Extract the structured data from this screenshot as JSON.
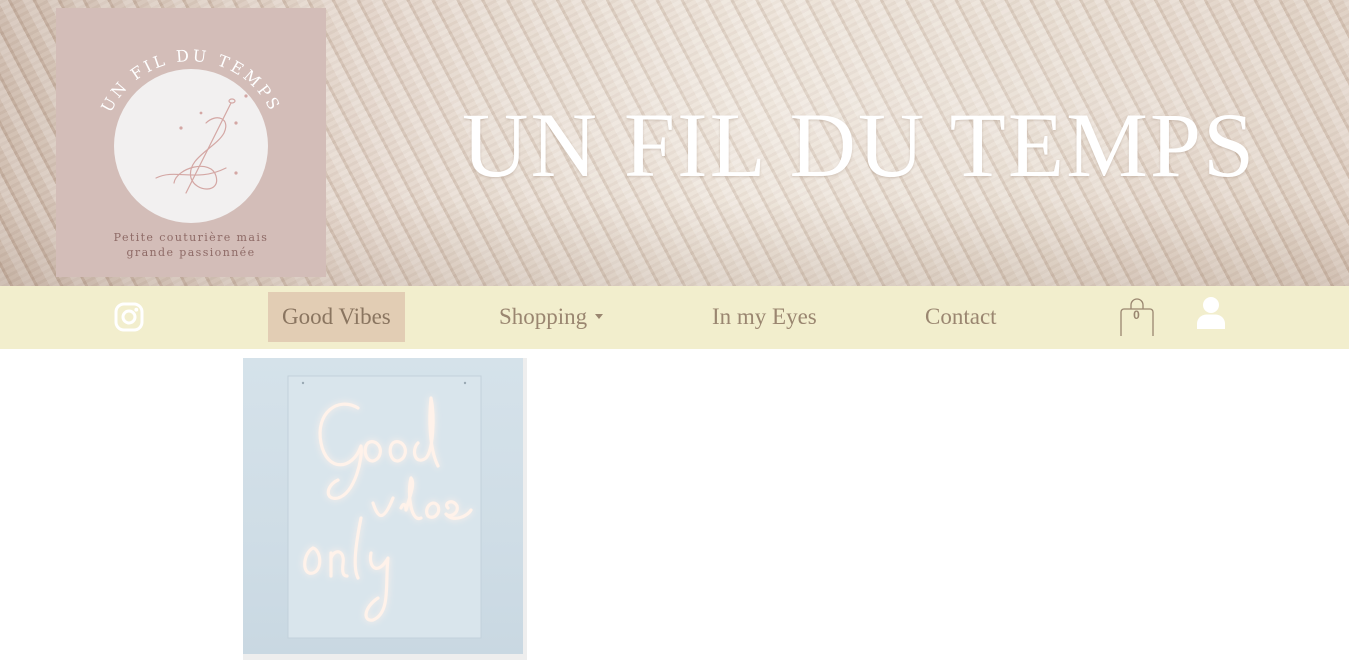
{
  "header": {
    "site_title": "UN FIL DU TEMPS",
    "logo": {
      "arc_text": "UN FIL DU TEMPS",
      "tagline_line1": "Petite couturière mais",
      "tagline_line2": "grande passionnée"
    }
  },
  "nav": {
    "items": [
      {
        "label": "Good Vibes",
        "active": true
      },
      {
        "label": "Shopping",
        "has_dropdown": true
      },
      {
        "label": "In my Eyes"
      },
      {
        "label": "Contact"
      }
    ],
    "cart_count": "0",
    "icons": [
      "instagram-icon",
      "cart-icon",
      "user-icon"
    ]
  },
  "content": {
    "card_image": {
      "neon_text": "Good vibes only"
    }
  },
  "colors": {
    "nav_bg": "#f2eecd",
    "active_bg": "#e2cdb4",
    "nav_text": "#9a8670",
    "logo_bg": "#d3bdb8",
    "title": "#ffffff"
  }
}
